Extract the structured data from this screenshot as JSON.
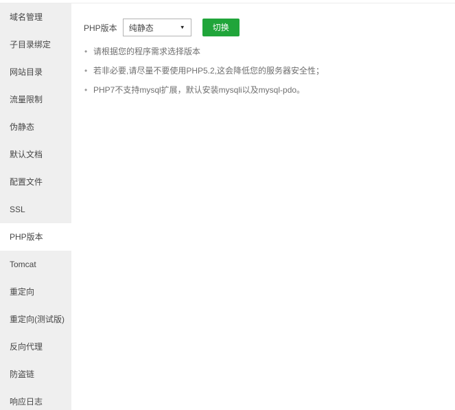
{
  "sidebar": {
    "items": [
      {
        "label": "域名管理",
        "active": false
      },
      {
        "label": "子目录绑定",
        "active": false
      },
      {
        "label": "网站目录",
        "active": false
      },
      {
        "label": "流量限制",
        "active": false
      },
      {
        "label": "伪静态",
        "active": false
      },
      {
        "label": "默认文档",
        "active": false
      },
      {
        "label": "配置文件",
        "active": false
      },
      {
        "label": "SSL",
        "active": false
      },
      {
        "label": "PHP版本",
        "active": true
      },
      {
        "label": "Tomcat",
        "active": false
      },
      {
        "label": "重定向",
        "active": false
      },
      {
        "label": "重定向(测试版)",
        "active": false
      },
      {
        "label": "反向代理",
        "active": false
      },
      {
        "label": "防盗链",
        "active": false
      },
      {
        "label": "响应日志",
        "active": false
      }
    ]
  },
  "main": {
    "php_version_label": "PHP版本",
    "select_value": "纯静态",
    "select_arrow": "▼",
    "switch_button": "切换",
    "tips": [
      "请根据您的程序需求选择版本",
      "若非必要,请尽量不要使用PHP5.2,这会降低您的服务器安全性；",
      "PHP7不支持mysql扩展，默认安装mysqli以及mysql-pdo。"
    ]
  },
  "colors": {
    "accent_green": "#20a53a",
    "sidebar_bg": "#efefef"
  }
}
